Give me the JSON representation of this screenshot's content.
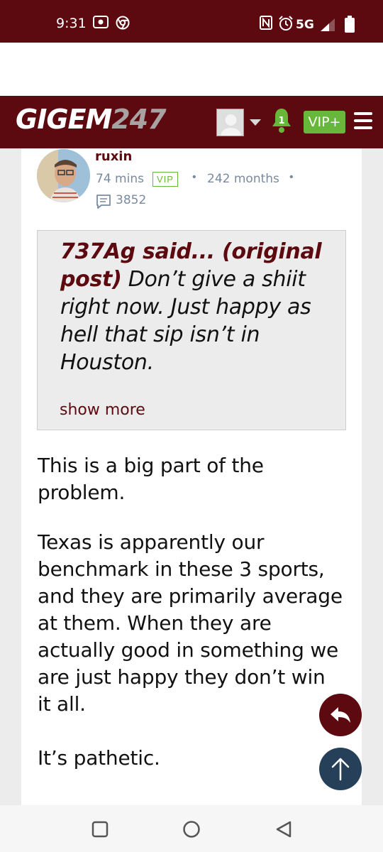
{
  "status_bar": {
    "time": "9:31",
    "network": "5G",
    "icons": [
      "screen-record-icon",
      "chrome-icon",
      "nfc-icon",
      "alarm-icon",
      "signal-icon",
      "battery-icon"
    ]
  },
  "header": {
    "logo_text": "GIGEM",
    "logo_number": "247",
    "notification_count": "1",
    "vip_label": "VIP+",
    "colors": {
      "brand": "#5c0a0f",
      "vip": "#67b83a"
    }
  },
  "post": {
    "username": "ruxin",
    "time_ago": "74 mins",
    "badge": "VIP",
    "tenure": "242 months",
    "message_count": "3852",
    "quote": {
      "author_link": "737Ag said... (original post)",
      "text": " Don’t give a shiit right now. Just happy as hell that sip isn’t in Houston.",
      "show_more": "show more"
    },
    "paragraphs": [
      "This is a big part of the problem.",
      "Texas is apparently our benchmark in these 3 sports, and they are primarily average at them. When they are actually good in something we are just happy they don’t win it all.",
      "It’s pathetic."
    ]
  },
  "nav": {
    "icons": [
      "recents-square-icon",
      "home-circle-icon",
      "back-triangle-icon"
    ]
  }
}
